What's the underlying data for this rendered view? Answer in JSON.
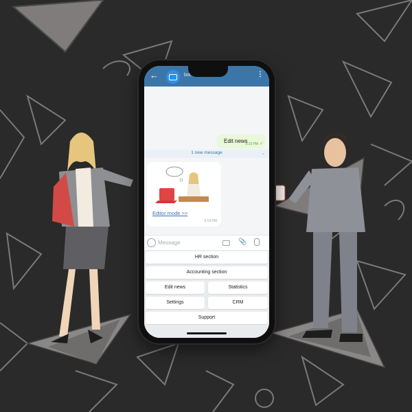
{
  "chat": {
    "title": "bot",
    "outgoing_message": {
      "text": "Edit news",
      "time": "9:19 PM"
    },
    "new_messages_label": "1 new message",
    "incoming_message": {
      "link_text": "Editor mode >>",
      "time": "9:19 PM"
    }
  },
  "composer": {
    "placeholder": "Message"
  },
  "keyboard": {
    "hr": "HR section",
    "accounting": "Accounting section",
    "edit_news": "Edit news",
    "statistics": "Statistics",
    "settings": "Settings",
    "crm": "CRM",
    "support": "Support"
  },
  "icons": {
    "back": "arrow-left-icon",
    "avatar": "bot-avatar-icon",
    "menu": "kebab-menu-icon",
    "emoji": "emoji-icon",
    "keyboard": "keyboard-icon",
    "attach": "paperclip-icon",
    "mic": "microphone-icon"
  },
  "colors": {
    "header": "#3c76a8",
    "bubble_outgoing": "#e9f8d8",
    "background": "#2a2a2a"
  }
}
